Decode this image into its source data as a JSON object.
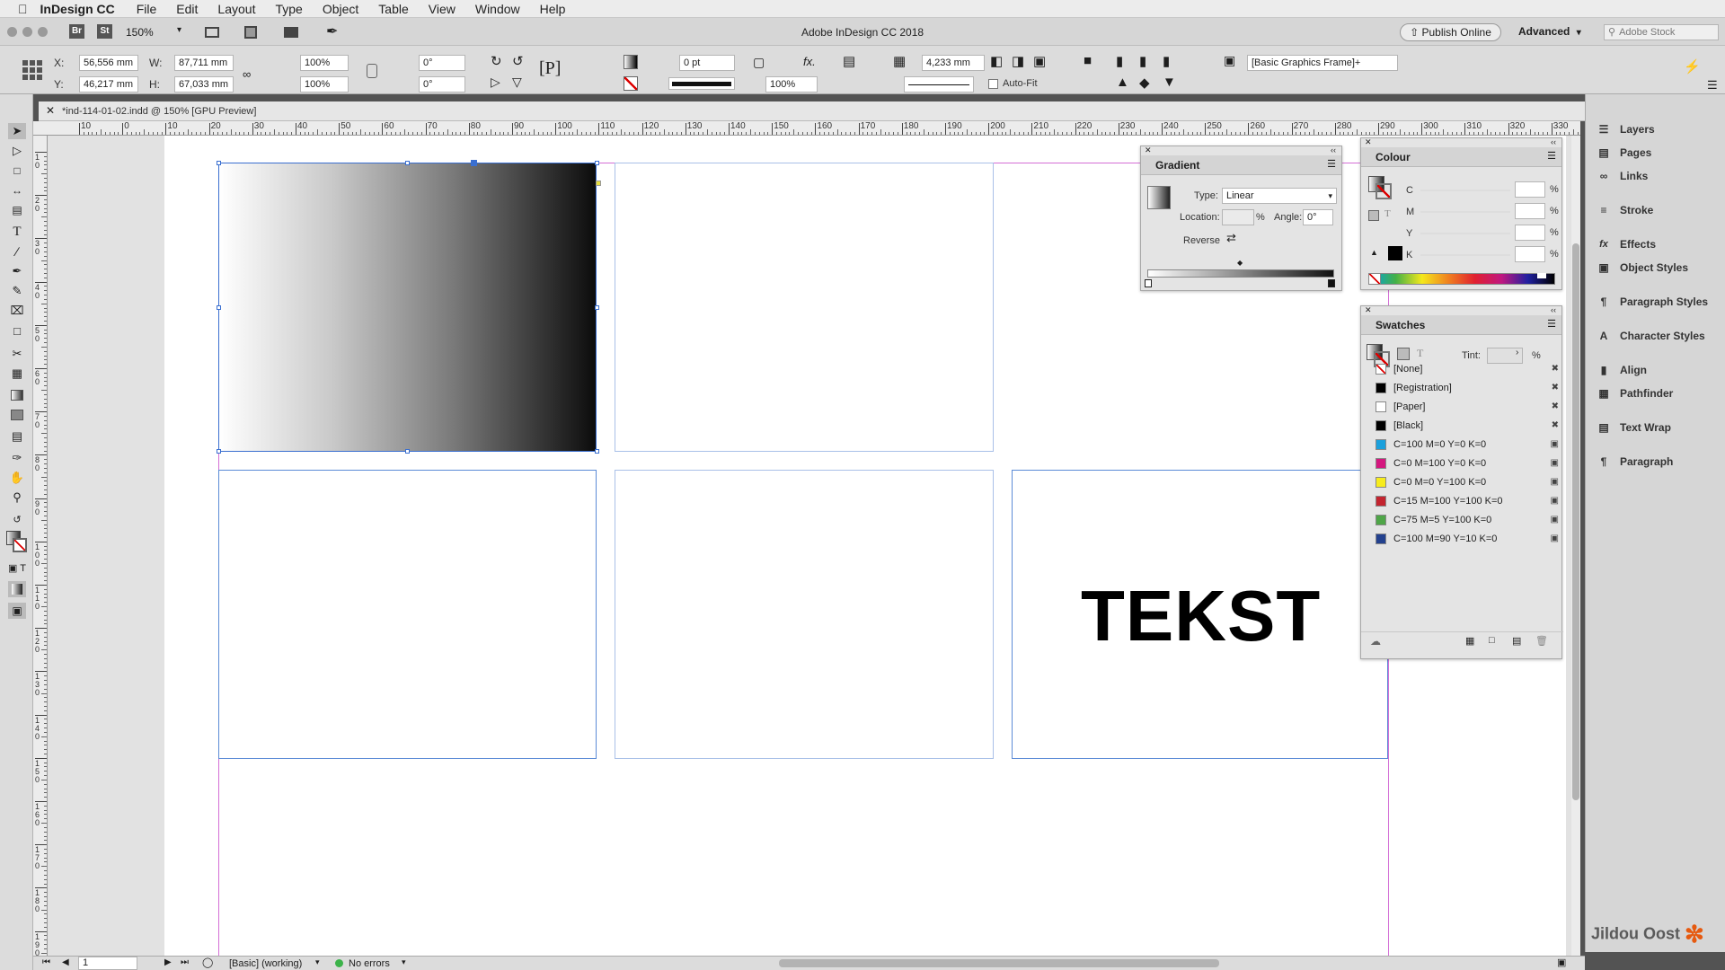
{
  "menubar": {
    "app": "InDesign CC",
    "items": [
      "File",
      "Edit",
      "Layout",
      "Type",
      "Object",
      "Table",
      "View",
      "Window",
      "Help"
    ]
  },
  "appbar": {
    "title": "Adobe InDesign CC 2018",
    "zoom": "150%",
    "bridge_label": "Br",
    "stock_label": "St",
    "publish_label": "Publish Online",
    "workspace_label": "Advanced",
    "search_placeholder": "Adobe Stock"
  },
  "control": {
    "x_label": "X:",
    "x_value": "56,556 mm",
    "y_label": "Y:",
    "y_value": "46,217 mm",
    "w_label": "W:",
    "w_value": "87,711 mm",
    "h_label": "H:",
    "h_value": "67,033 mm",
    "scale_x": "100%",
    "scale_y": "100%",
    "rotate": "0°",
    "shear": "0°",
    "stroke_weight": "0 pt",
    "opacity": "100%",
    "offset": "4,233 mm",
    "autofit_label": "Auto-Fit",
    "object_style": "[Basic Graphics Frame]+"
  },
  "document": {
    "tab": "*ind-114-01-02.indd @ 150% [GPU Preview]",
    "text": "TEKST"
  },
  "rulers": {
    "h_ticks": [
      "10",
      "0",
      "10",
      "20",
      "30",
      "40",
      "50",
      "60",
      "70",
      "80",
      "90",
      "100",
      "110",
      "120",
      "130",
      "140",
      "150",
      "160",
      "170",
      "180",
      "190",
      "200",
      "210",
      "220",
      "230",
      "240",
      "250",
      "260",
      "270",
      "280",
      "290",
      "300",
      "310",
      "320",
      "330"
    ],
    "v_ticks": [
      "1\n0",
      "2\n0",
      "3\n0",
      "4\n0",
      "5\n0",
      "6\n0",
      "7\n0",
      "8\n0",
      "9\n0",
      "1\n0\n0",
      "1\n1\n0",
      "1\n2\n0",
      "1\n3\n0",
      "1\n4\n0",
      "1\n5\n0",
      "1\n6\n0",
      "1\n7\n0",
      "1\n8\n0",
      "1\n9\n0"
    ]
  },
  "gradient": {
    "title": "Gradient",
    "type_label": "Type:",
    "type_value": "Linear",
    "location_label": "Location:",
    "location_value": "",
    "percent": "%",
    "angle_label": "Angle:",
    "angle_value": "0°",
    "reverse_label": "Reverse"
  },
  "colour": {
    "title": "Colour",
    "channels": [
      "C",
      "M",
      "Y",
      "K"
    ],
    "percent": "%"
  },
  "swatches": {
    "title": "Swatches",
    "tint_label": "Tint:",
    "tint_percent": "%",
    "items": [
      {
        "name": "[None]",
        "color": "none"
      },
      {
        "name": "[Registration]",
        "color": "#000000"
      },
      {
        "name": "[Paper]",
        "color": "#ffffff"
      },
      {
        "name": "[Black]",
        "color": "#000000"
      },
      {
        "name": "C=100 M=0 Y=0 K=0",
        "color": "#1ba0dc"
      },
      {
        "name": "C=0 M=100 Y=0 K=0",
        "color": "#d4177f"
      },
      {
        "name": "C=0 M=0 Y=100 K=0",
        "color": "#f7ec1c"
      },
      {
        "name": "C=15 M=100 Y=100 K=0",
        "color": "#c3242f"
      },
      {
        "name": "C=75 M=5 Y=100 K=0",
        "color": "#4ea547"
      },
      {
        "name": "C=100 M=90 Y=10 K=0",
        "color": "#23418e"
      }
    ]
  },
  "dock": {
    "items": [
      "Layers",
      "Pages",
      "Links",
      "Stroke",
      "Effects",
      "Object Styles",
      "Paragraph Styles",
      "Character Styles",
      "Align",
      "Pathfinder",
      "Text Wrap",
      "Paragraph"
    ]
  },
  "status": {
    "page": "1",
    "preflight_profile": "[Basic] (working)",
    "errors": "No errors"
  },
  "watermark": "Jildou Oost"
}
